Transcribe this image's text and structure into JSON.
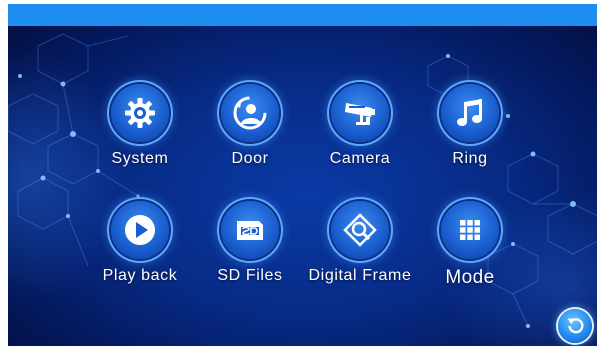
{
  "menu": {
    "row1": [
      {
        "label": "System",
        "icon": "gear-icon"
      },
      {
        "label": "Door",
        "icon": "door-user-icon"
      },
      {
        "label": "Camera",
        "icon": "camera-icon"
      },
      {
        "label": "Ring",
        "icon": "music-note-icon"
      }
    ],
    "row2": [
      {
        "label": "Play back",
        "icon": "play-icon"
      },
      {
        "label": "SD Files",
        "icon": "sd-card-icon"
      },
      {
        "label": "Digital Frame",
        "icon": "photo-frame-icon"
      },
      {
        "label": "Mode",
        "icon": "grid-icon"
      }
    ]
  },
  "back_button": {
    "icon": "back-arrow-icon"
  },
  "colors": {
    "topbar": "#1e8ff0",
    "background": "#072b86",
    "icon_fill": "#1a5fd0"
  }
}
